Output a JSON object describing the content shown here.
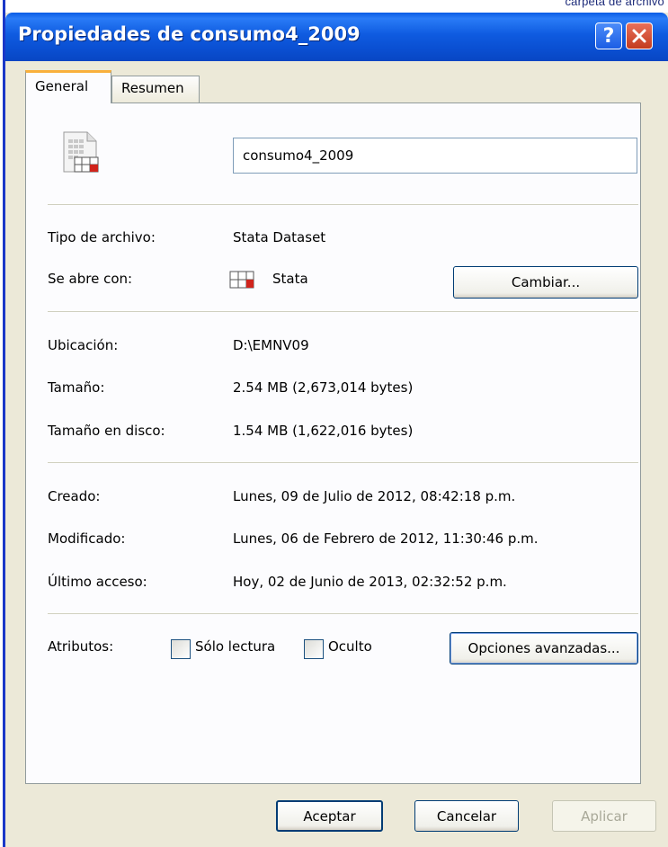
{
  "background": {
    "corner_text": "carpeta de archivo"
  },
  "window": {
    "title": "Propiedades de consumo4_2009",
    "help_button": "?",
    "close_button": "X"
  },
  "tabs": [
    {
      "label": "General",
      "active": true
    },
    {
      "label": "Resumen",
      "active": false
    }
  ],
  "general": {
    "file_name": "consumo4_2009",
    "file_type_label": "Tipo de archivo:",
    "file_type_value": "Stata Dataset",
    "opens_with_label": "Se abre con:",
    "opens_with_value": "Stata",
    "change_button": "Cambiar...",
    "location_label": "Ubicación:",
    "location_value": "D:\\EMNV09",
    "size_label": "Tamaño:",
    "size_value": "2.54 MB (2,673,014 bytes)",
    "disk_size_label": "Tamaño en disco:",
    "disk_size_value": "1.54 MB (1,622,016 bytes)",
    "created_label": "Creado:",
    "created_value": "Lunes, 09 de Julio de 2012, 08:42:18 p.m.",
    "modified_label": "Modificado:",
    "modified_value": "Lunes, 06 de Febrero de 2012, 11:30:46 p.m.",
    "accessed_label": "Último acceso:",
    "accessed_value": "Hoy, 02 de Junio de 2013, 02:32:52 p.m.",
    "attributes_label": "Atributos:",
    "readonly_label": "Sólo lectura",
    "readonly_checked": false,
    "hidden_label": "Oculto",
    "hidden_checked": false,
    "advanced_button": "Opciones avanzadas..."
  },
  "footer": {
    "ok_button": "Aceptar",
    "cancel_button": "Cancelar",
    "apply_button": "Aplicar"
  },
  "colors": {
    "titlebar": "#0a5ce6",
    "face": "#ece9d8",
    "tab_highlight": "#f9b03c",
    "close_red": "#c33b1e"
  }
}
